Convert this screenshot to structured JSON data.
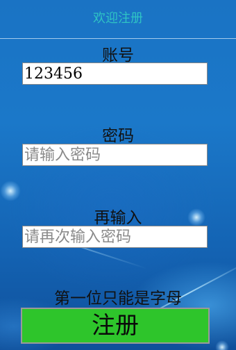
{
  "header": {
    "title": "欢迎注册"
  },
  "form": {
    "account": {
      "label": "账号",
      "value": "123456",
      "placeholder": ""
    },
    "password": {
      "label": "密码",
      "value": "",
      "placeholder": "请输入密码"
    },
    "confirm_password": {
      "label": "再输入",
      "value": "",
      "placeholder": "请再次输入密码"
    },
    "hint": "第一位只能是字母",
    "submit_label": "注册"
  },
  "colors": {
    "title": "#2fc4c4",
    "submit_background": "#2ec52b",
    "background": "#1a73c4"
  }
}
